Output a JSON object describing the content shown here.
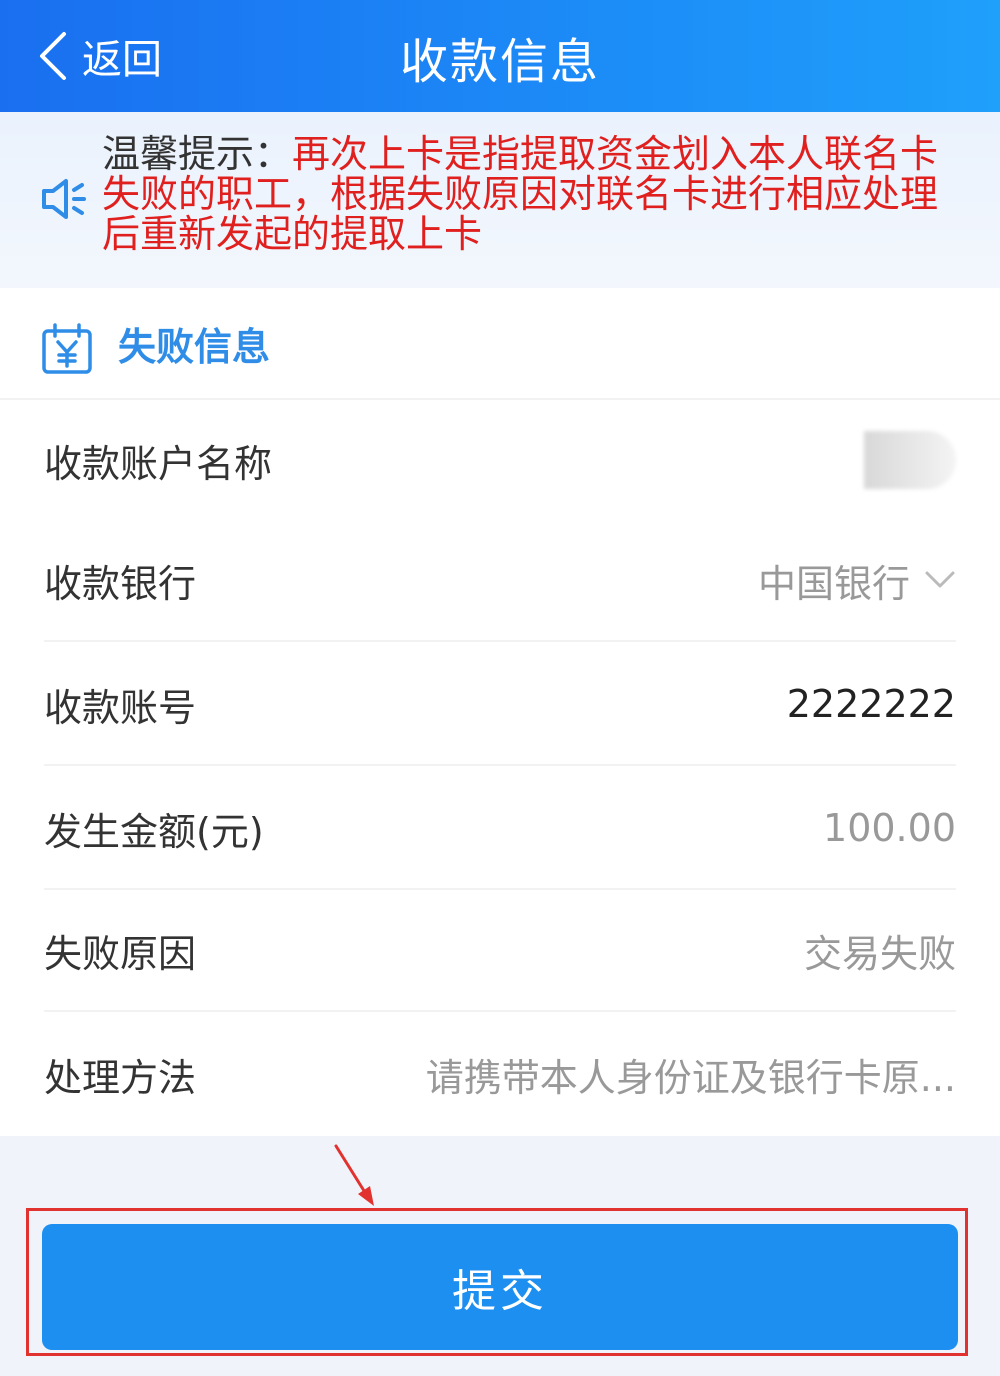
{
  "header": {
    "back_label": "返回",
    "title": "收款信息"
  },
  "notice": {
    "prefix": "温馨提示：",
    "text": "再次上卡是指提取资金划入本人联名卡失败的职工，根据失败原因对联名卡进行相应处理后重新发起的提取上卡"
  },
  "section": {
    "title": "失败信息"
  },
  "fields": {
    "account_name_label": "收款账户名称",
    "bank_label": "收款银行",
    "bank_value": "中国银行",
    "account_no_label": "收款账号",
    "account_no_value": "2222222",
    "amount_label": "发生金额(元)",
    "amount_value": "100.00",
    "reason_label": "失败原因",
    "reason_value": "交易失败",
    "method_label": "处理方法",
    "method_value": "请携带本人身份证及银行卡原..."
  },
  "submit": {
    "label": "提交"
  },
  "colors": {
    "header_blue": "#1c8cf7",
    "accent_blue": "#2f8de8",
    "button_blue": "#1c8ff0",
    "notice_red": "#e0201f",
    "annotation_red": "#e2322f"
  },
  "icons": [
    "chevron-left-icon",
    "speaker-icon",
    "calendar-yen-icon",
    "chevron-down-icon",
    "annotation-arrow-icon"
  ]
}
